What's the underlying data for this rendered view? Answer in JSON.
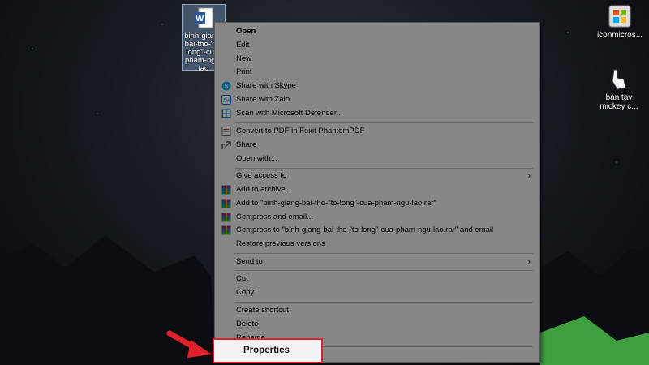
{
  "desktop": {
    "word_file_label": "binh-giang-bai-tho-\"to-long\"-cua-pham-ngu-lao",
    "ms_icon_label": "iconmicros...",
    "mickey_icon_label": "bàn tay mickey c..."
  },
  "context_menu": {
    "items": [
      {
        "label": "Open",
        "icon": "none"
      },
      {
        "label": "Edit",
        "icon": "none"
      },
      {
        "label": "New",
        "icon": "none"
      },
      {
        "label": "Print",
        "icon": "none"
      },
      {
        "label": "Share with Skype",
        "icon": "skype-icon"
      },
      {
        "label": "Share with Zalo",
        "icon": "zalo-icon"
      },
      {
        "label": "Scan with Microsoft Defender...",
        "icon": "defender-icon"
      },
      {
        "label": "Convert to PDF in Foxit PhantomPDF",
        "icon": "foxit-icon"
      },
      {
        "label": "Share",
        "icon": "share-icon"
      },
      {
        "label": "Open with...",
        "icon": "none"
      },
      {
        "label": "Give access to",
        "icon": "none"
      },
      {
        "label": "Add to archive...",
        "icon": "winrar-icon"
      },
      {
        "label": "Add to \"binh-giang-bai-tho-\"to-long\"-cua-pham-ngu-lao.rar\"",
        "icon": "winrar-icon"
      },
      {
        "label": "Compress and email...",
        "icon": "winrar-icon"
      },
      {
        "label": "Compress to \"binh-giang-bai-tho-\"to-long\"-cua-pham-ngu-lao.rar\" and email",
        "icon": "winrar-icon"
      },
      {
        "label": "Restore previous versions",
        "icon": "none"
      },
      {
        "label": "Send to",
        "icon": "none"
      },
      {
        "label": "Cut",
        "icon": "none"
      },
      {
        "label": "Copy",
        "icon": "none"
      },
      {
        "label": "Create shortcut",
        "icon": "none"
      },
      {
        "label": "Delete",
        "icon": "none"
      },
      {
        "label": "Rename",
        "icon": "none"
      },
      {
        "label": "Properties",
        "icon": "none"
      }
    ],
    "submenu_arrow": "›"
  },
  "colors": {
    "highlight_border": "#e0202a",
    "arrow": "#e0202a"
  }
}
